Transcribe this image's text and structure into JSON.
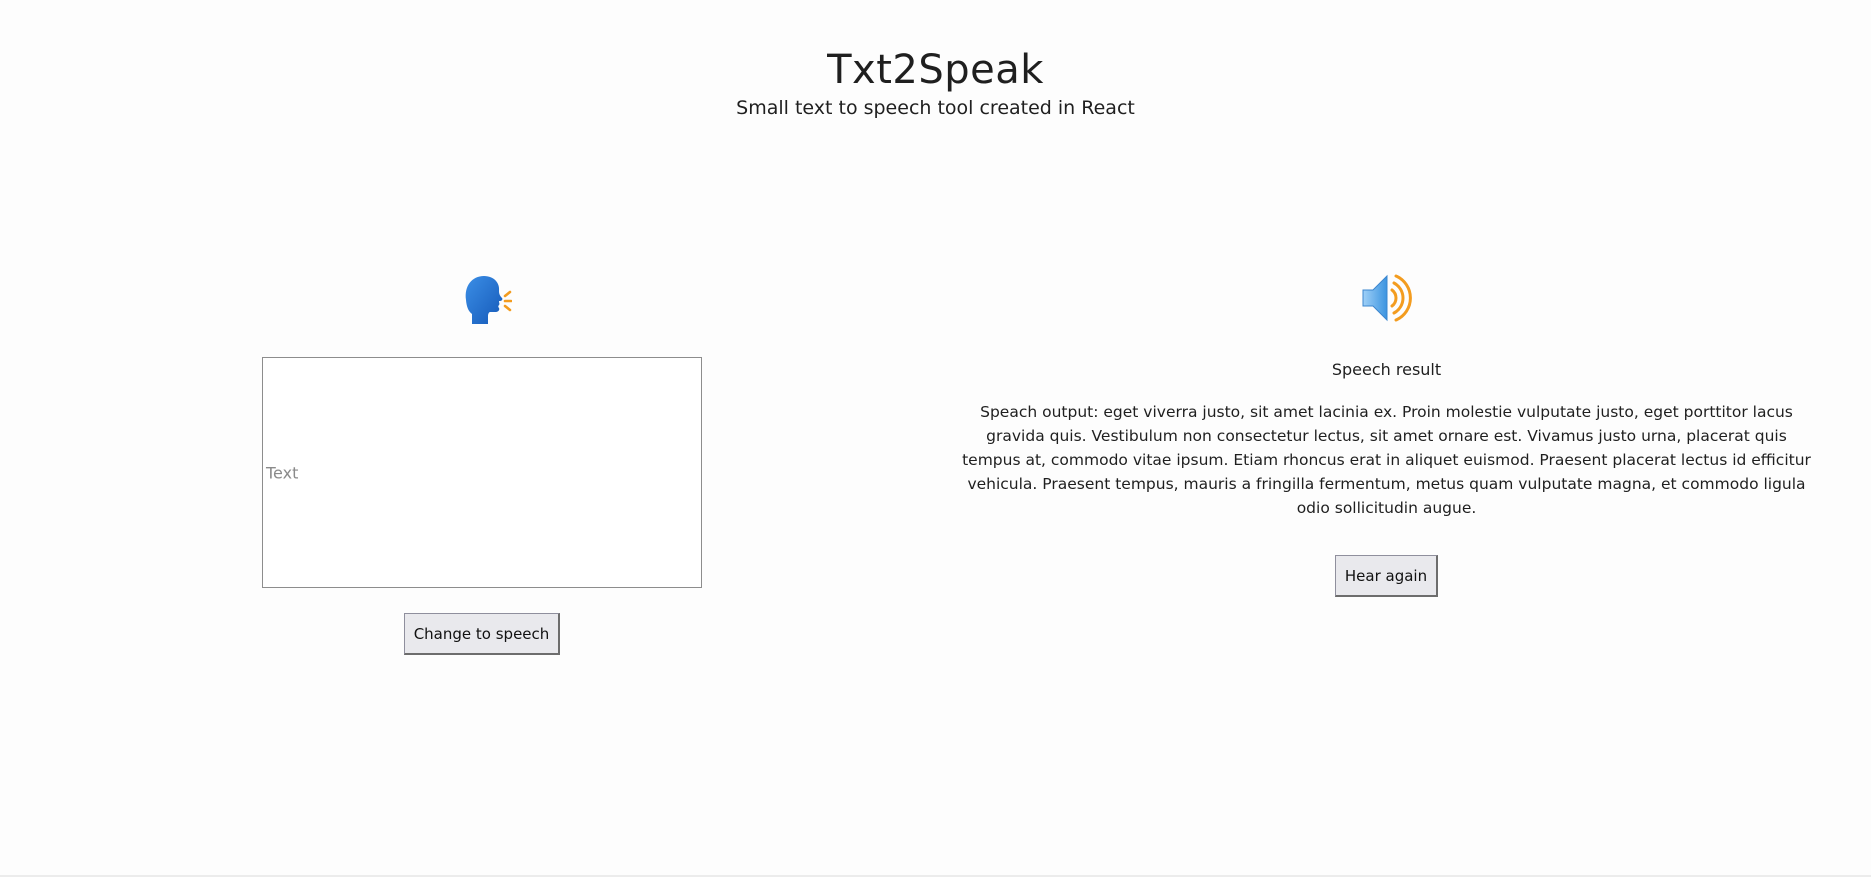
{
  "header": {
    "title": "Txt2Speak",
    "subtitle": "Small text to speech tool created in React"
  },
  "input_panel": {
    "icon": "speaking-head-icon",
    "textarea_placeholder": "Text",
    "textarea_value": "",
    "button_label": "Change to speech"
  },
  "result_panel": {
    "icon": "speaker-high-volume-icon",
    "label": "Speech result",
    "output_text": "Speach output: eget viverra justo, sit amet lacinia ex. Proin molestie vulputate justo, eget porttitor lacus gravida quis. Vestibulum non consectetur lectus, sit amet ornare est. Vivamus justo urna, placerat quis tempus at, commodo vitae ipsum. Etiam rhoncus erat in aliquet euismod. Praesent placerat lectus id efficitur vehicula. Praesent tempus, mauris a fringilla fermentum, metus quam vulputate magna, et commodo ligula odio sollicitudin augue.",
    "button_label": "Hear again"
  },
  "colors": {
    "icon_blue": "#1e6fd0",
    "icon_orange": "#f39c1f",
    "background": "#fdfdfd"
  }
}
